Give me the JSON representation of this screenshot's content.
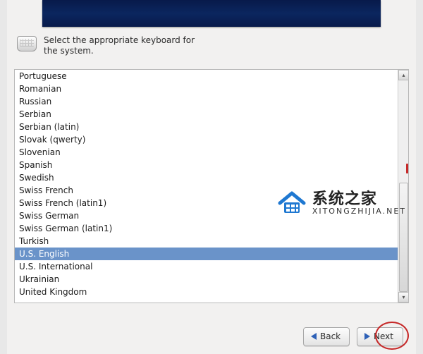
{
  "instruction": "Select the appropriate keyboard for\nthe system.",
  "keyboards": [
    "Portuguese",
    "Romanian",
    "Russian",
    "Serbian",
    "Serbian (latin)",
    "Slovak (qwerty)",
    "Slovenian",
    "Spanish",
    "Swedish",
    "Swiss French",
    "Swiss French (latin1)",
    "Swiss German",
    "Swiss German (latin1)",
    "Turkish",
    "U.S. English",
    "U.S. International",
    "Ukrainian",
    "United Kingdom"
  ],
  "selected_index": 14,
  "buttons": {
    "back": "Back",
    "next": "Next"
  },
  "watermark": {
    "title": "系统之家",
    "url": "XITONGZHIJIA.NET"
  }
}
